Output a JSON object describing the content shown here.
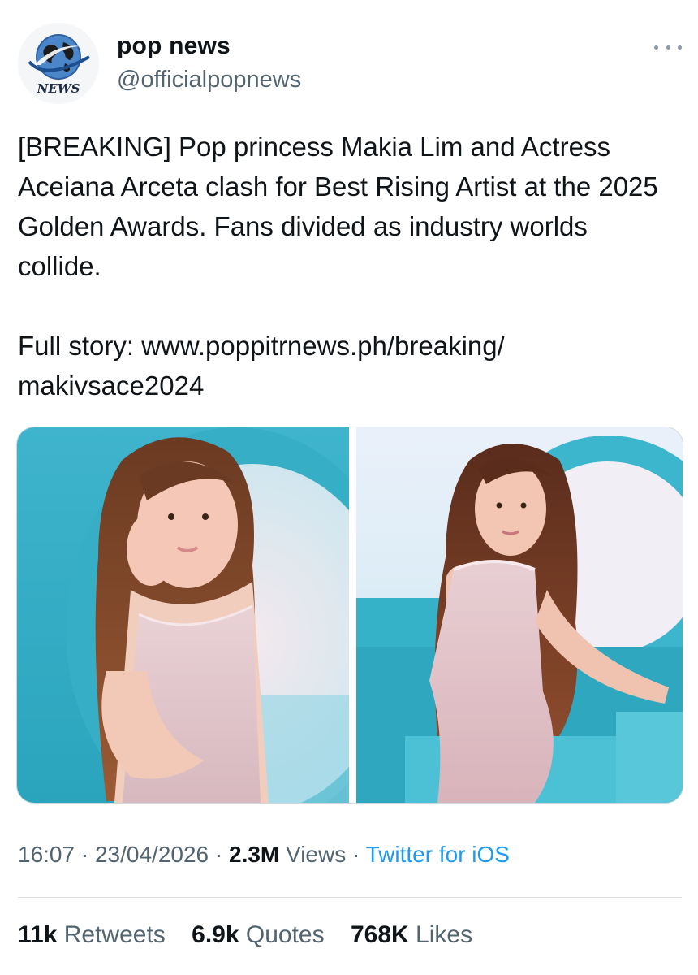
{
  "account": {
    "name": "pop news",
    "handle": "@officialpopnews",
    "logo_text": "NEWS"
  },
  "tweet": {
    "paragraphs": [
      "[BREAKING] Pop princess Makia Lim and Actress Aceiana Arceta clash for Best Rising Artist at the 2025 Golden Awards. Fans divided as industry worlds collide.",
      "Full story: www.poppitrnews.ph/breaking/ makivsace2024"
    ],
    "time": "16:07",
    "date": "23/04/2026",
    "views_count": "2.3M",
    "views_label": "Views",
    "source": "Twitter for iOS",
    "separator": "·"
  },
  "stats": {
    "retweets_count": "11k",
    "retweets_label": "Retweets",
    "quotes_count": "6.9k",
    "quotes_label": "Quotes",
    "likes_count": "768K",
    "likes_label": "Likes"
  },
  "colors": {
    "text": "#0f1419",
    "secondary": "#536471",
    "link": "#1d9bf0",
    "photo_backdrop": "#3bb3c9"
  },
  "icons": {
    "more": "more-horizontal-icon",
    "logo": "globe-icon"
  }
}
